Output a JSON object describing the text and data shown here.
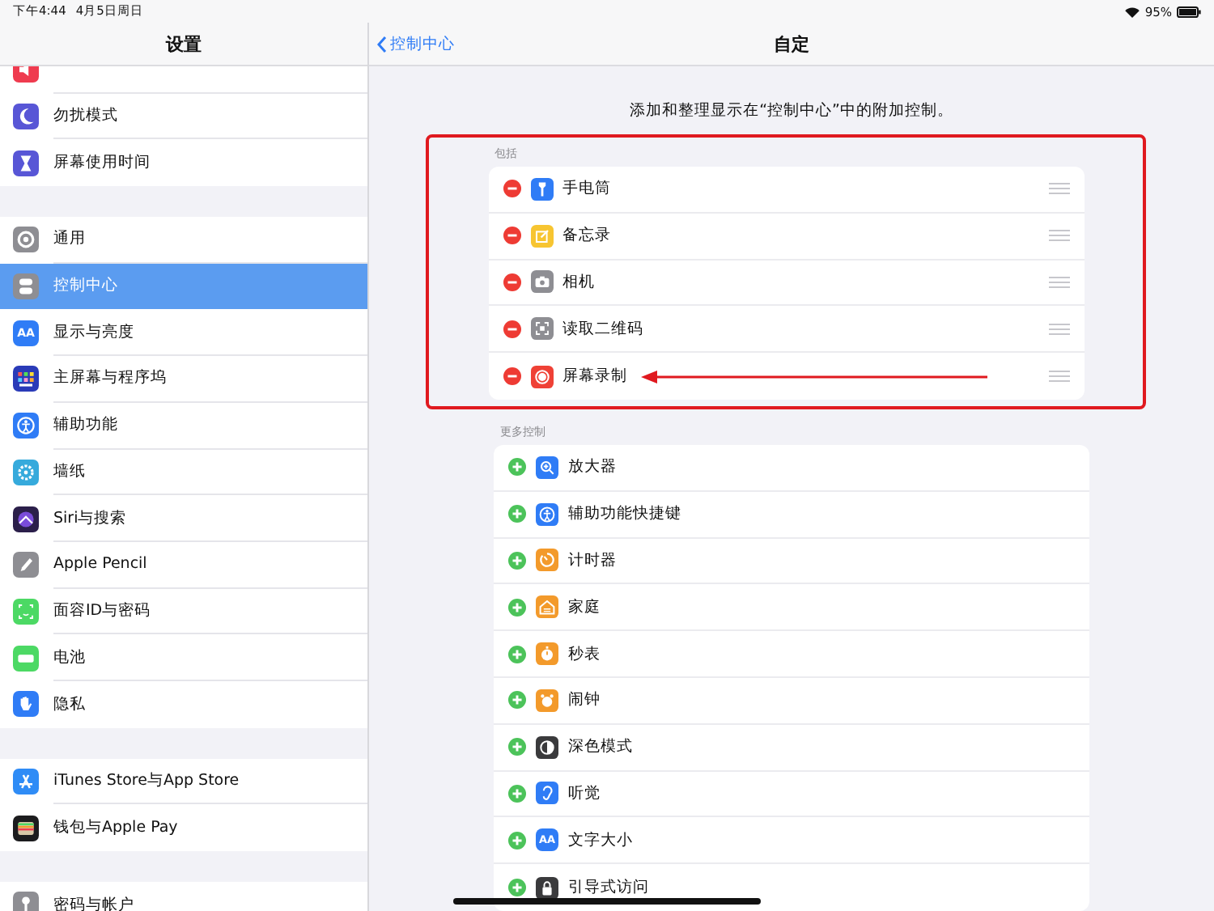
{
  "status_bar": {
    "time": "下午4:44",
    "date": "4月5日周日",
    "battery": "95%"
  },
  "sidebar": {
    "title": "设置",
    "sections": [
      [
        {
          "label": "勿扰模式",
          "selected": false
        },
        {
          "label": "屏幕使用时间",
          "selected": false
        }
      ],
      [
        {
          "label": "通用",
          "selected": false
        },
        {
          "label": "控制中心",
          "selected": true
        },
        {
          "label": "显示与亮度",
          "glyph": "AA",
          "selected": false
        },
        {
          "label": "主屏幕与程序坞",
          "selected": false
        },
        {
          "label": "辅助功能",
          "selected": false
        },
        {
          "label": "墙纸",
          "selected": false
        },
        {
          "label": "Siri与搜索",
          "selected": false
        },
        {
          "label": "Apple Pencil",
          "selected": false
        },
        {
          "label": "面容ID与密码",
          "selected": false
        },
        {
          "label": "电池",
          "selected": false
        },
        {
          "label": "隐私",
          "selected": false
        }
      ],
      [
        {
          "label": "iTunes Store与App Store",
          "selected": false
        },
        {
          "label": "钱包与Apple Pay",
          "selected": false
        }
      ],
      [
        {
          "label": "密码与帐户",
          "selected": false
        }
      ]
    ]
  },
  "detail": {
    "back": "控制中心",
    "title": "自定",
    "description": "添加和整理显示在“控制中心”中的附加控制。",
    "included": {
      "header": "包括",
      "highlighted": true,
      "items": [
        {
          "label": "手电筒",
          "arrow": false
        },
        {
          "label": "备忘录",
          "arrow": false
        },
        {
          "label": "相机",
          "arrow": false
        },
        {
          "label": "读取二维码",
          "arrow": false
        },
        {
          "label": "屏幕录制",
          "arrow": true
        }
      ]
    },
    "more": {
      "header": "更多控制",
      "items": [
        {
          "label": "放大器"
        },
        {
          "label": "辅助功能快捷键"
        },
        {
          "label": "计时器"
        },
        {
          "label": "家庭"
        },
        {
          "label": "秒表"
        },
        {
          "label": "闹钟"
        },
        {
          "label": "深色模式"
        },
        {
          "label": "听觉"
        },
        {
          "label": "文字大小",
          "glyph": "AA"
        },
        {
          "label": "引导式访问"
        }
      ]
    }
  }
}
